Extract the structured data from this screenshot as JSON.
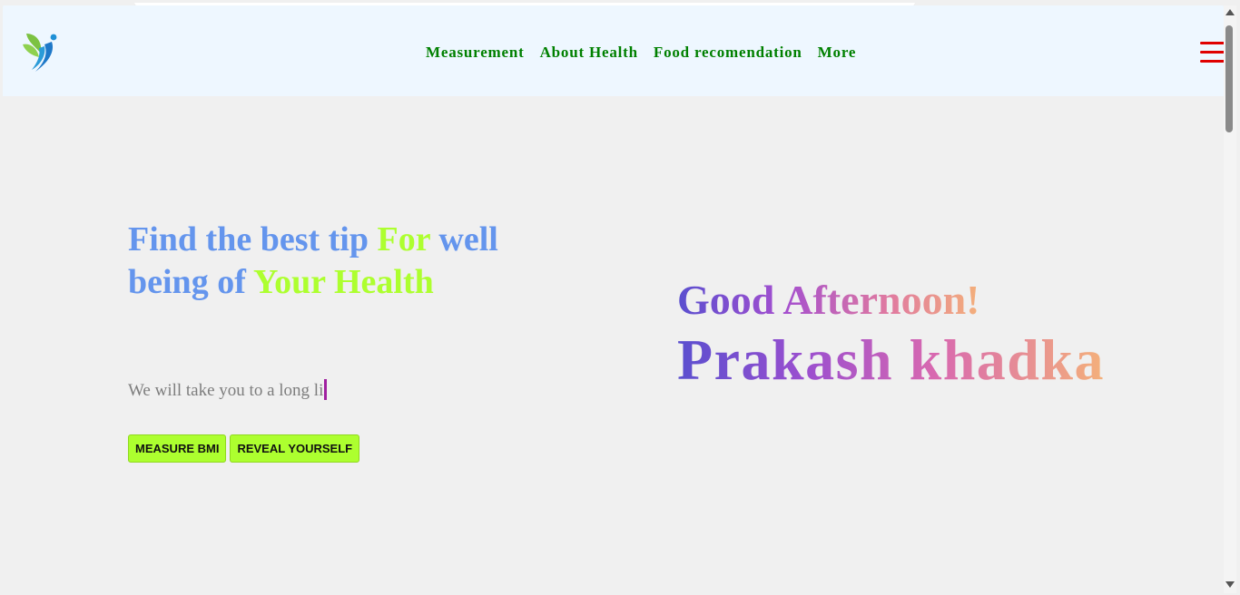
{
  "nav": {
    "links": [
      "Measurement",
      "About Health",
      "Food recomendation",
      "More"
    ]
  },
  "hero": {
    "title_part1": "Find the best tip ",
    "title_hl1": "For",
    "title_part2": " well being of ",
    "title_hl2": "Your",
    "title_part3": " ",
    "title_hl3": "Health",
    "tagline": "We will take you to a long li",
    "buttons": {
      "measure": "MEASURE BMI",
      "reveal": "REVEAL YOURSELF"
    }
  },
  "greeting": {
    "text": "Good Afternoon!",
    "name": "Prakash khadka"
  },
  "colors": {
    "nav_link": "#008000",
    "title_blue": "#6495ed",
    "title_highlight": "#adff2f",
    "button_bg": "#adff2f",
    "menu_red": "#e00000",
    "caret": "#a020a0"
  },
  "icons": {
    "logo": "leaf-figure-logo",
    "menu": "hamburger-menu-icon"
  }
}
